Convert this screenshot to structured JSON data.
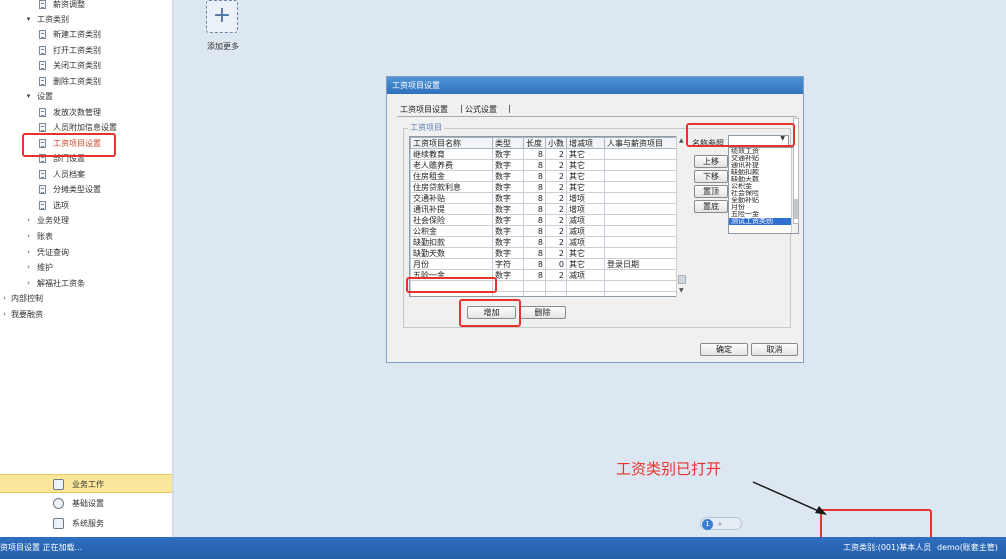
{
  "sidebar": {
    "items": [
      {
        "label": "薪资调整",
        "level": 2,
        "icon": "doc"
      },
      {
        "label": "工资类别",
        "level": 1,
        "expanded": true
      },
      {
        "label": "新建工资类别",
        "level": 2,
        "icon": "doc"
      },
      {
        "label": "打开工资类别",
        "level": 2,
        "icon": "doc"
      },
      {
        "label": "关闭工资类别",
        "level": 2,
        "icon": "doc"
      },
      {
        "label": "删除工资类别",
        "level": 2,
        "icon": "doc"
      },
      {
        "label": "设置",
        "level": 1,
        "expanded": true
      },
      {
        "label": "发放次数管理",
        "level": 2,
        "icon": "doc"
      },
      {
        "label": "人员附加信息设置",
        "level": 2,
        "icon": "doc"
      },
      {
        "label": "工资项目设置",
        "level": 2,
        "icon": "doc",
        "active": true
      },
      {
        "label": "部门设置",
        "level": 2,
        "icon": "doc"
      },
      {
        "label": "人员档案",
        "level": 2,
        "icon": "doc"
      },
      {
        "label": "分摊类型设置",
        "level": 2,
        "icon": "doc"
      },
      {
        "label": "选项",
        "level": 2,
        "icon": "doc"
      },
      {
        "label": "业务处理",
        "level": 1,
        "expanded": false
      },
      {
        "label": "账表",
        "level": 1,
        "expanded": false
      },
      {
        "label": "凭证查询",
        "level": 1,
        "expanded": false
      },
      {
        "label": "维护",
        "level": 1,
        "expanded": false
      },
      {
        "label": "解福社工资条",
        "level": 1,
        "expanded": false
      },
      {
        "label": "内部控制",
        "level": 0,
        "expanded": false
      },
      {
        "label": "我要融资",
        "level": 0,
        "expanded": false
      }
    ]
  },
  "bottom_panel": {
    "items": [
      {
        "label": "业务工作",
        "active": true
      },
      {
        "label": "基础设置",
        "active": false
      },
      {
        "label": "系统服务",
        "active": false
      }
    ]
  },
  "workspace": {
    "add_more_label": "添加更多"
  },
  "dialog": {
    "title": "工资项目设置",
    "tabs": [
      "工资项目设置",
      "公式设置"
    ],
    "group_title": "工资项目",
    "columns": [
      "工资项目名称",
      "类型",
      "长度",
      "小数",
      "增减项",
      "人事与薪资项目"
    ],
    "rows": [
      [
        "继续教育",
        "数字",
        "8",
        "2",
        "其它",
        ""
      ],
      [
        "老人赡养费",
        "数字",
        "8",
        "2",
        "其它",
        ""
      ],
      [
        "住房租金",
        "数字",
        "8",
        "2",
        "其它",
        ""
      ],
      [
        "住房贷款利息",
        "数字",
        "8",
        "2",
        "其它",
        ""
      ],
      [
        "交通补贴",
        "数字",
        "8",
        "2",
        "增项",
        ""
      ],
      [
        "通讯补提",
        "数字",
        "8",
        "2",
        "增项",
        ""
      ],
      [
        "社会保险",
        "数字",
        "8",
        "2",
        "减项",
        ""
      ],
      [
        "公积金",
        "数字",
        "8",
        "2",
        "减项",
        ""
      ],
      [
        "缺勤扣款",
        "数字",
        "8",
        "2",
        "减项",
        ""
      ],
      [
        "缺勤天数",
        "数字",
        "8",
        "2",
        "其它",
        ""
      ],
      [
        "月份",
        "字符",
        "8",
        "0",
        "其它",
        "登录日期"
      ],
      [
        "五险一金",
        "数字",
        "8",
        "2",
        "减项",
        ""
      ]
    ],
    "name_ref_label": "名称参照",
    "name_ref_value": "",
    "name_ref_options": [
      "绩效工资",
      "交通补贴",
      "通讯补提",
      "缺勤扣款",
      "缺勤天数",
      "公积金",
      "社会保险",
      "全勤补贴",
      "月份",
      "五险一金",
      "测试工资类别"
    ],
    "selected_option_index": 10,
    "buttons": {
      "move_up": "上移",
      "move_down": "下移",
      "to_top": "置顶",
      "to_bottom": "置底",
      "add": "增加",
      "delete": "删除",
      "ok": "确定",
      "cancel": "取消"
    }
  },
  "annotation": {
    "text": "工资类别已打开",
    "color": "#e8322d"
  },
  "pager": {
    "current": "1"
  },
  "statusbar": {
    "left": "资项目设置 正在加载...",
    "category": "工资类别:(001)基本人员",
    "user": "demo(账套主管)"
  },
  "colors": {
    "status_bar": "#2a67b4",
    "highlight_box": "#e8322d",
    "active_tab": "#fbe79b"
  }
}
